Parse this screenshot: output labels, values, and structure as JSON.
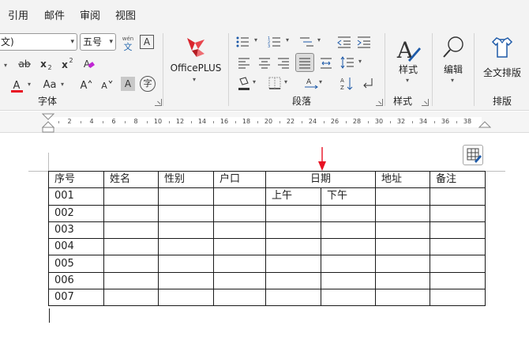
{
  "menu": [
    "引用",
    "邮件",
    "审阅",
    "视图"
  ],
  "font": {
    "name_value": "文)",
    "size_value": "五号",
    "group_label": "字体"
  },
  "paragraph": {
    "group_label": "段落"
  },
  "officeplus": {
    "label": "OfficePLUS"
  },
  "styles": {
    "button_label": "样式",
    "group_label": "样式"
  },
  "editing": {
    "button_label": "编辑"
  },
  "layout": {
    "button_label": "全文排版",
    "group_label": "排版"
  },
  "ruler": [
    "2",
    "4",
    "6",
    "8",
    "10",
    "12",
    "14",
    "16",
    "18",
    "20",
    "22",
    "24",
    "26",
    "28",
    "30",
    "32",
    "34",
    "36",
    "38"
  ],
  "colors": {
    "accent_red": "#e81123",
    "table_border": "#1a1a1a"
  },
  "table": {
    "headers": [
      "序号",
      "姓名",
      "性别",
      "户口",
      "日期",
      "地址",
      "备注"
    ],
    "date_sub": [
      "上午",
      "下午"
    ],
    "rows": [
      "001",
      "002",
      "003",
      "004",
      "005",
      "006",
      "007"
    ]
  }
}
